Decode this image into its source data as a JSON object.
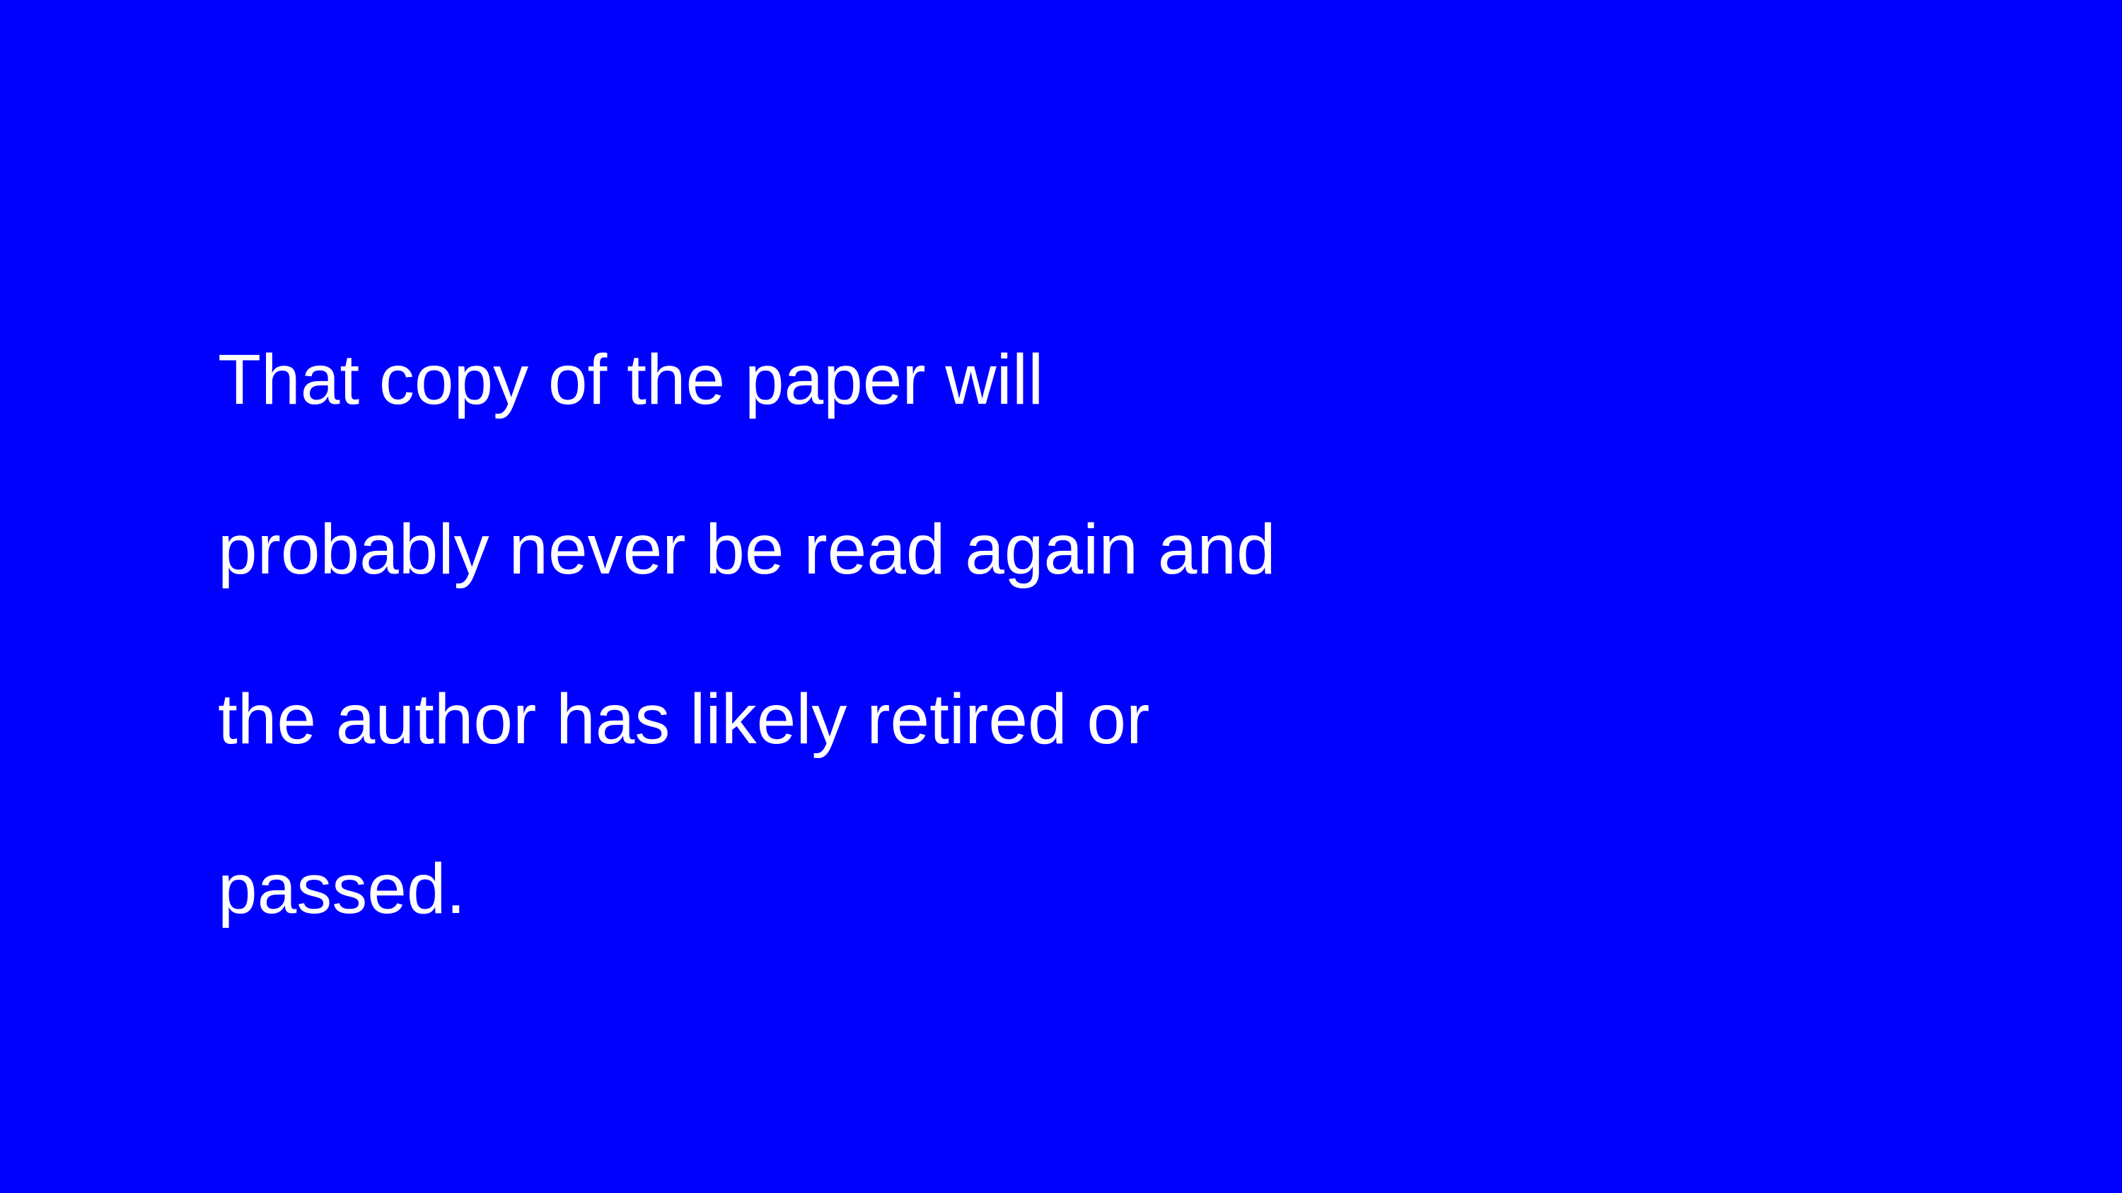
{
  "slide": {
    "background_color": "#0000FF",
    "text_color": "#FFFFFF",
    "lines": [
      "That copy of the paper will",
      "probably never be read again and",
      "the author has likely retired or",
      "passed."
    ]
  }
}
